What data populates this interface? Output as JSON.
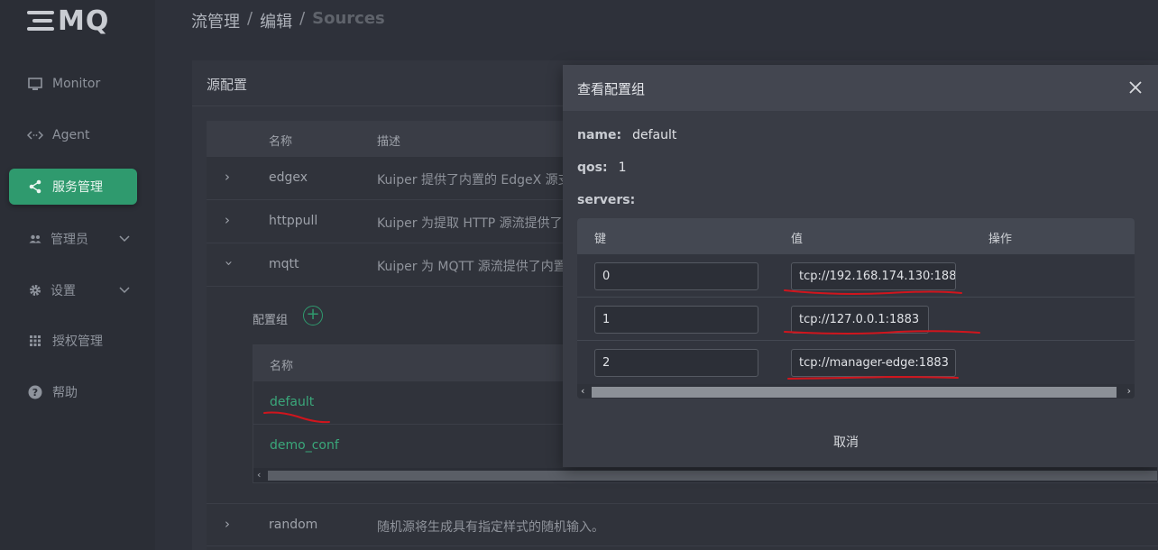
{
  "logo": {
    "text": "MQ"
  },
  "sidebar": {
    "items": [
      {
        "label": "Monitor"
      },
      {
        "label": "Agent"
      },
      {
        "label": "服务管理"
      },
      {
        "label": "管理员"
      },
      {
        "label": "设置"
      },
      {
        "label": "授权管理"
      },
      {
        "label": "帮助"
      }
    ]
  },
  "breadcrumb": {
    "items": [
      "流管理",
      "编辑",
      "Sources"
    ],
    "sep": "/"
  },
  "card": {
    "title": "源配置"
  },
  "table": {
    "headers": {
      "name": "名称",
      "desc": "描述"
    },
    "rows": [
      {
        "name": "edgex",
        "desc": "Kuiper 提供了内置的 EdgeX 源支"
      },
      {
        "name": "httppull",
        "desc": "Kuiper 为提取 HTTP 源流提供了内"
      },
      {
        "name": "mqtt",
        "desc": "Kuiper 为 MQTT 源流提供了内置"
      },
      {
        "name": "random",
        "desc": "随机源将生成具有指定样式的随机输入。"
      }
    ]
  },
  "config_group": {
    "title": "配置组",
    "header": "名称",
    "rows": [
      "default",
      "demo_conf"
    ]
  },
  "dialog": {
    "title": "查看配置组",
    "name_label": "name:",
    "name_value": "default",
    "qos_label": "qos:",
    "qos_value": "1",
    "servers_label": "servers:",
    "headers": {
      "key": "键",
      "value": "值",
      "action": "操作"
    },
    "rows": [
      {
        "key": "0",
        "value": "tcp://192.168.174.130:188"
      },
      {
        "key": "1",
        "value": "tcp://127.0.0.1:1883"
      },
      {
        "key": "2",
        "value": "tcp://manager-edge:1883"
      }
    ],
    "cancel": "取消"
  },
  "colors": {
    "accent": "#2f9a6e",
    "annotation": "#d0151d",
    "link": "#3aa77a"
  }
}
